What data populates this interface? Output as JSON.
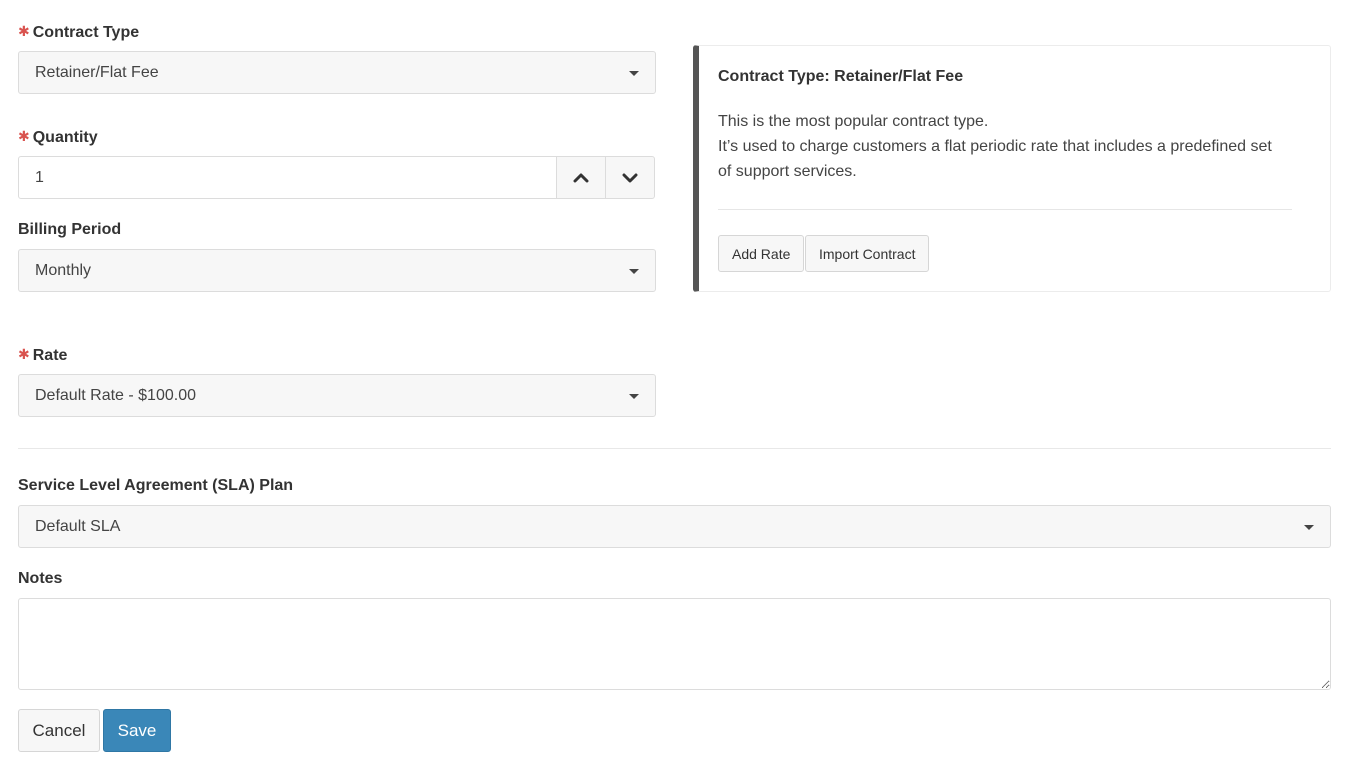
{
  "form": {
    "contract_type": {
      "label": "Contract Type",
      "required_mark": "✱",
      "value": "Retainer/Flat Fee"
    },
    "quantity": {
      "label": "Quantity",
      "required_mark": "✱",
      "value": "1"
    },
    "billing_period": {
      "label": "Billing Period",
      "value": "Monthly"
    },
    "rate": {
      "label": "Rate",
      "required_mark": "✱",
      "value": "Default Rate - $100.00"
    },
    "sla_plan": {
      "label": "Service Level Agreement (SLA) Plan",
      "value": "Default SLA"
    },
    "notes": {
      "label": "Notes",
      "value": ""
    }
  },
  "info_panel": {
    "title": "Contract Type: Retainer/Flat Fee",
    "lines": [
      "This is the most popular contract type.",
      "It’s used to charge customers a flat periodic rate that includes a predefined set",
      "of support services."
    ],
    "add_rate_label": "Add Rate",
    "import_contract_label": "Import Contract"
  },
  "actions": {
    "cancel_label": "Cancel",
    "save_label": "Save"
  },
  "icons": {
    "required": "asterisk-icon",
    "dropdown": "caret-down-icon",
    "increment": "chevron-up-icon",
    "decrement": "chevron-down-icon"
  },
  "colors": {
    "required_mark": "#d9534f",
    "primary_button": "#3a87b8",
    "panel_accent": "#555555"
  }
}
